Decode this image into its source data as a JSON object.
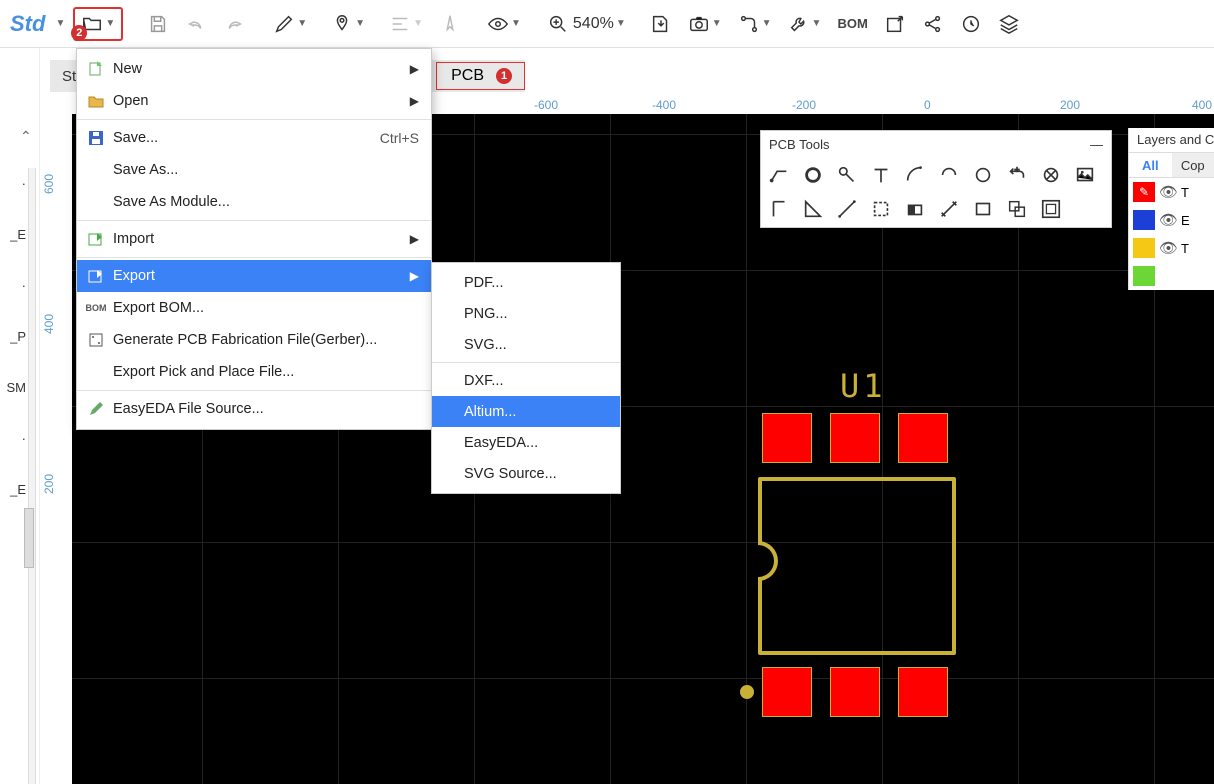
{
  "toolbar": {
    "std_label": "Std",
    "zoom_text": "540%",
    "bom_label": "BOM",
    "highlight_badge": "2"
  },
  "tabs": {
    "current_partial": "Sta",
    "pcb_label": "PCB",
    "pcb_badge": "1"
  },
  "ruler_h": [
    "-600",
    "-400",
    "-200",
    "0",
    "200",
    "400"
  ],
  "ruler_v": [
    "600",
    "400",
    "200"
  ],
  "sidebar_items": [
    "·",
    "_E",
    "·",
    "_P",
    "SM",
    "·",
    "_E"
  ],
  "file_menu": {
    "new": "New",
    "open": "Open",
    "save": "Save...",
    "save_shortcut": "Ctrl+S",
    "save_as": "Save As...",
    "save_module": "Save As Module...",
    "import": "Import",
    "export": "Export",
    "export_bom": "Export BOM...",
    "gerber": "Generate PCB Fabrication File(Gerber)...",
    "pick_place": "Export Pick and Place File...",
    "file_source": "EasyEDA File Source..."
  },
  "export_submenu": {
    "pdf": "PDF...",
    "png": "PNG...",
    "svg": "SVG...",
    "dxf": "DXF...",
    "altium": "Altium...",
    "easyeda": "EasyEDA...",
    "svg_source": "SVG Source..."
  },
  "pcb_tools": {
    "title": "PCB Tools",
    "collapse": "—"
  },
  "layers_panel": {
    "title": "Layers and C",
    "tabs": {
      "all": "All",
      "cop": "Cop"
    },
    "rows": [
      "T",
      "E",
      "T"
    ]
  },
  "component": {
    "designator": "U1"
  }
}
